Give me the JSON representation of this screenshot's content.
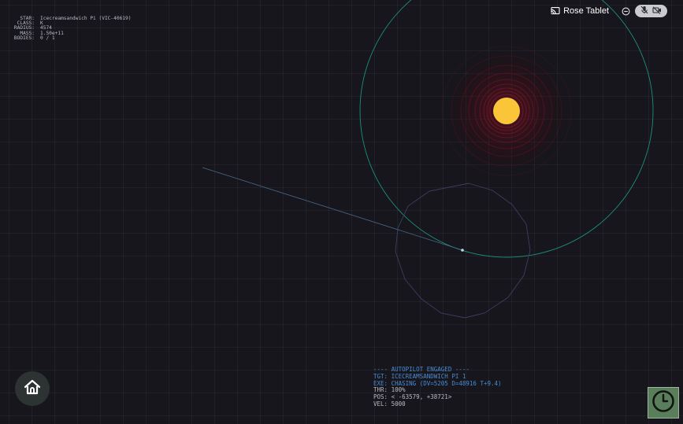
{
  "star_info": [
    {
      "key": "STAR:",
      "value": "Icecreamsandwich Pi (VIC-40619)"
    },
    {
      "key": "CLASS:",
      "value": "K"
    },
    {
      "key": "RADIUS:",
      "value": "4574"
    },
    {
      "key": "MASS:",
      "value": "1.50e+11"
    },
    {
      "key": "BODIES:",
      "value": "0 / 1"
    }
  ],
  "topbar": {
    "device_name": "Rose Tablet",
    "cast_icon": "cast-icon",
    "minus_icon": "minus-circle-icon",
    "mic_icon": "mic-off-icon",
    "camera_icon": "camera-off-icon"
  },
  "autopilot": {
    "header": "---- AUTOPILOT ENGAGED ----",
    "tgt": "TGT: ICECREAMSANDWICH PI 1",
    "exe": "EXE: CHASING (DV=5205 D=48916 T+9.4)",
    "thr": "THR: 100%",
    "pos": "POS: < -63579, +38721>",
    "vel": "VEL: 5000"
  },
  "buttons": {
    "home_icon": "home-icon",
    "clock_icon": "clock-icon"
  },
  "colors": {
    "background": "#16161c",
    "star": "#fbc53a",
    "star_glow": "#8b1a2a",
    "orbit": "#1c8f79",
    "planet_orbit": "#3b3f63",
    "autopilot_text": "#4a8cd6",
    "clock_button": "#5a7e5c"
  }
}
